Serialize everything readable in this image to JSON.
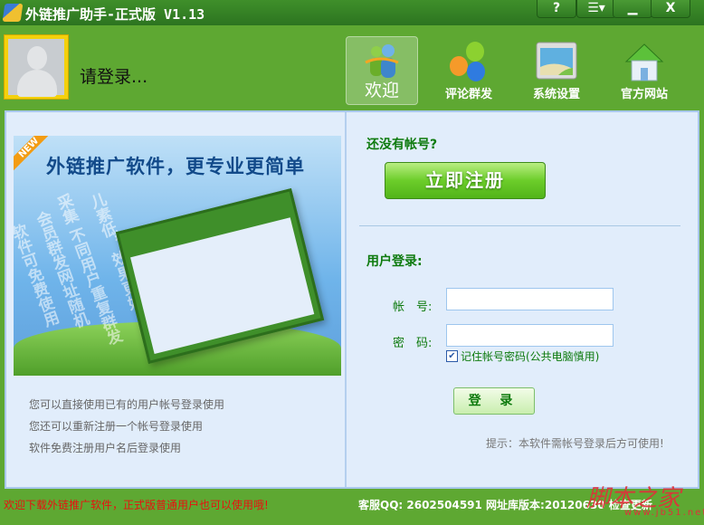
{
  "window": {
    "title": "外链推广助手-正式版 V1.13",
    "buttons": {
      "help": "?",
      "menu": "☰▾",
      "minimize": "▁",
      "close": "X"
    }
  },
  "header": {
    "login_prompt": "请登录...",
    "nav": [
      {
        "label": "欢迎",
        "icon": "users-icon",
        "active": true
      },
      {
        "label": "评论群发",
        "icon": "bubbles-icon"
      },
      {
        "label": "系统设置",
        "icon": "settings-window-icon"
      },
      {
        "label": "官方网站",
        "icon": "house-icon"
      }
    ]
  },
  "banner": {
    "badge": "NEW",
    "slogan": "外链推广软件，更专业更简单",
    "slanted": [
      "软件可免费使用",
      "会员群发网址随机",
      "采集 不同用户重复群发",
      "儿素低，效果更好"
    ]
  },
  "left_tips": [
    "您可以直接使用已有的用户帐号登录使用",
    "您还可以重新注册一个帐号登录使用",
    "软件免费注册用户名后登录使用"
  ],
  "register": {
    "heading": "还没有帐号?",
    "button": "立即注册"
  },
  "login": {
    "heading": "用户登录:",
    "account_label": "帐　号:",
    "account_value": "",
    "password_label": "密　码:",
    "password_value": "",
    "remember_label": "记住帐号密码(公共电脑慎用)",
    "remember_checked": true,
    "button": "登 录",
    "hint": "提示：本软件需帐号登录后方可使用!"
  },
  "footer": {
    "notice": "欢迎下载外链推广软件，正式版普通用户也可以使用哦!",
    "info": "客服QQ: 2602504591 网址库版本:20120630  检查更新"
  },
  "watermark": {
    "text": "脚本之家",
    "url": "www.jb51.net"
  }
}
